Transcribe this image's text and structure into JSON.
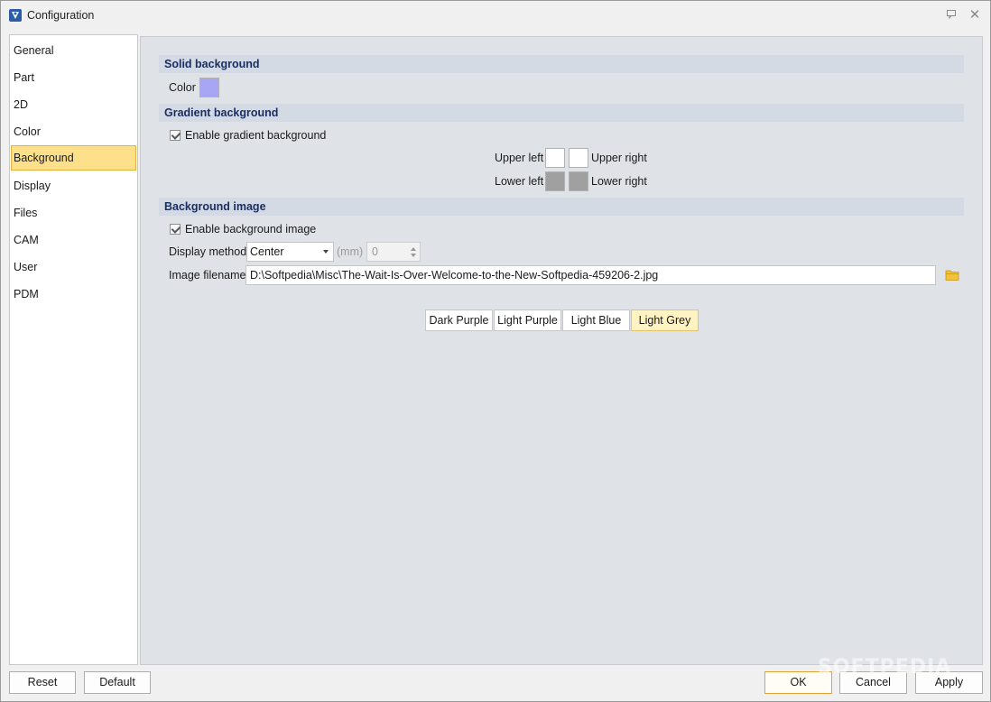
{
  "window": {
    "title": "Configuration",
    "restore_icon": "restore-icon",
    "close_glyph": "✕"
  },
  "sidebar": {
    "items": [
      {
        "label": "General"
      },
      {
        "label": "Part"
      },
      {
        "label": "2D"
      },
      {
        "label": "Color"
      },
      {
        "label": "Background",
        "selected": true
      },
      {
        "label": "Display"
      },
      {
        "label": "Files"
      },
      {
        "label": "CAM"
      },
      {
        "label": "User"
      },
      {
        "label": "PDM"
      }
    ]
  },
  "solid_background": {
    "header": "Solid background",
    "color_label": "Color",
    "color_value": "#a6a6f5"
  },
  "gradient_background": {
    "header": "Gradient background",
    "enable_label": "Enable gradient background",
    "enabled": true,
    "upper_left_label": "Upper left",
    "upper_right_label": "Upper right",
    "lower_left_label": "Lower left",
    "lower_right_label": "Lower right",
    "upper_left_color": "#ffffff",
    "upper_right_color": "#ffffff",
    "lower_left_color": "#a0a0a0",
    "lower_right_color": "#a0a0a0"
  },
  "background_image": {
    "header": "Background image",
    "enable_label": "Enable background image",
    "enabled": true,
    "display_method_label": "Display method",
    "display_method_value": "Center",
    "unit_label": "(mm)",
    "offset_value": "0",
    "filename_label": "Image filename",
    "filename_value": "D:\\Softpedia\\Misc\\The-Wait-Is-Over-Welcome-to-the-New-Softpedia-459206-2.jpg",
    "folder_icon": "folder-icon"
  },
  "presets": [
    {
      "label": "Dark Purple"
    },
    {
      "label": "Light Purple"
    },
    {
      "label": "Light Blue"
    },
    {
      "label": "Light Grey",
      "selected": true
    }
  ],
  "footer": {
    "reset_label": "Reset",
    "default_label": "Default",
    "ok_label": "OK",
    "cancel_label": "Cancel",
    "apply_label": "Apply"
  },
  "watermark": "SOFTPEDIA",
  "colors": {
    "selection_bg": "#ffe08a",
    "content_bg": "#dfe3e8",
    "header_text": "#1b2e63",
    "default_button_border": "#e0a436"
  }
}
